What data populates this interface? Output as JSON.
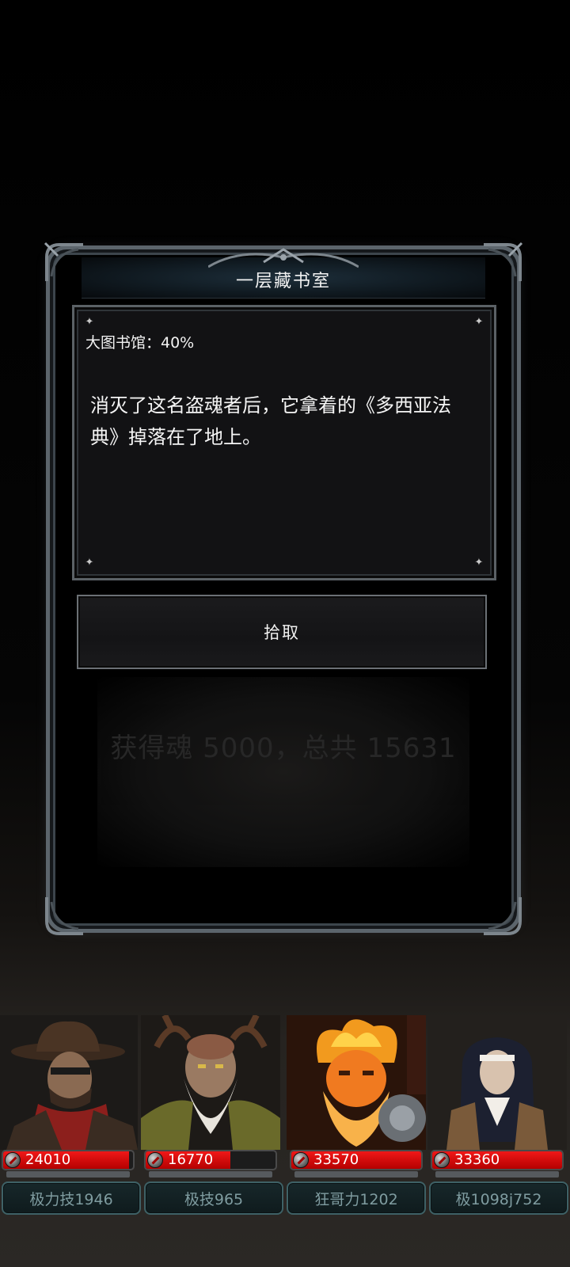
{
  "dialog": {
    "title": "一层藏书室",
    "location": "大图书馆：40%",
    "story": "消灭了这名盗魂者后，它拿着的《多西亚法典》掉落在了地上。",
    "action_button": "拾取",
    "faded_reward": "获得魂 5000，总共 15631"
  },
  "heroes": [
    {
      "hp": "24010",
      "hp_fraction": 0.97,
      "name": "极力技1946",
      "icon": "cowboy-portrait"
    },
    {
      "hp": "16770",
      "hp_fraction": 0.65,
      "name": "极技965",
      "icon": "druid-portrait"
    },
    {
      "hp": "33570",
      "hp_fraction": 1.0,
      "name": "狂哥力1202",
      "icon": "fire-dwarf-portrait"
    },
    {
      "hp": "33360",
      "hp_fraction": 1.0,
      "name": "极1098j752",
      "icon": "nun-portrait"
    }
  ],
  "colors": {
    "hp_red": "#e01010",
    "panel_border": "#5c656c",
    "name_tag_border": "#3e6166",
    "name_text": "#7f9ca0"
  }
}
